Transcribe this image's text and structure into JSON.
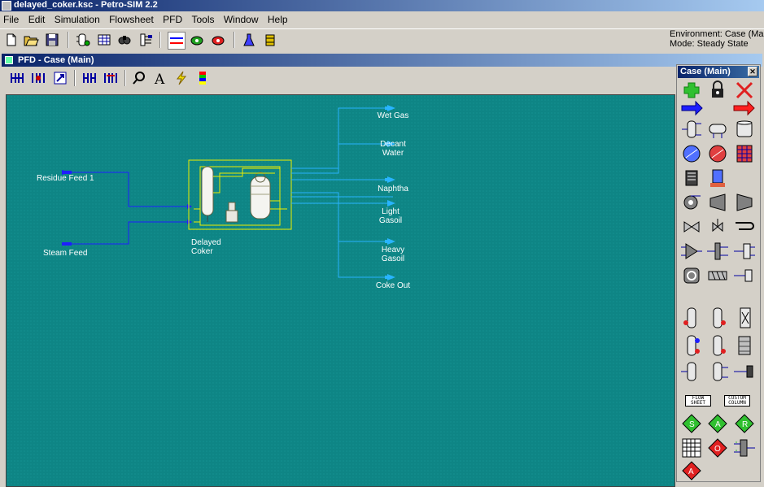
{
  "window": {
    "title": "delayed_coker.ksc - Petro-SIM 2.2"
  },
  "menu": [
    "File",
    "Edit",
    "Simulation",
    "Flowsheet",
    "PFD",
    "Tools",
    "Window",
    "Help"
  ],
  "toolbar_icons": [
    "new-icon",
    "open-icon",
    "save-icon",
    "simulation-basis-icon",
    "workbook-icon",
    "find-icon",
    "flowsheet-icon",
    "pfd-icon",
    "active-solver-icon",
    "hold-solver-icon",
    "lab-icon",
    "oil-icon"
  ],
  "environment": {
    "line1": "Environment: Case (Main)",
    "line2": "Mode: Steady State"
  },
  "pfd": {
    "title": "PFD - Case (Main)",
    "toolbar_icons": [
      "size-mode-icon",
      "auto-position-icon",
      "zoom-fit-icon",
      "layout-icon",
      "attach-mode-icon",
      "zoom-icon",
      "label-icon",
      "color-icon",
      "colour-scheme-icon"
    ],
    "feeds": {
      "residue": "Residue Feed 1",
      "steam": "Steam Feed"
    },
    "unit": {
      "line1": "Delayed",
      "line2": "Coker"
    },
    "products": [
      {
        "line1": "Wet Gas",
        "line2": ""
      },
      {
        "line1": "Decant",
        "line2": "Water"
      },
      {
        "line1": "Naphtha",
        "line2": ""
      },
      {
        "line1": "Light",
        "line2": "Gasoil"
      },
      {
        "line1": "Heavy",
        "line2": "Gasoil"
      },
      {
        "line1": "Coke Out",
        "line2": ""
      }
    ]
  },
  "palette": {
    "title": "Case (Main)",
    "flowsheet_label": "FLOW SHEET",
    "column_label": "CUSTOM COLUMN"
  },
  "colors": {
    "canvas": "#0e8585",
    "stream_feed": "#1e1eff",
    "stream_product": "#28b4ff",
    "unit_box": "#f0f000"
  }
}
